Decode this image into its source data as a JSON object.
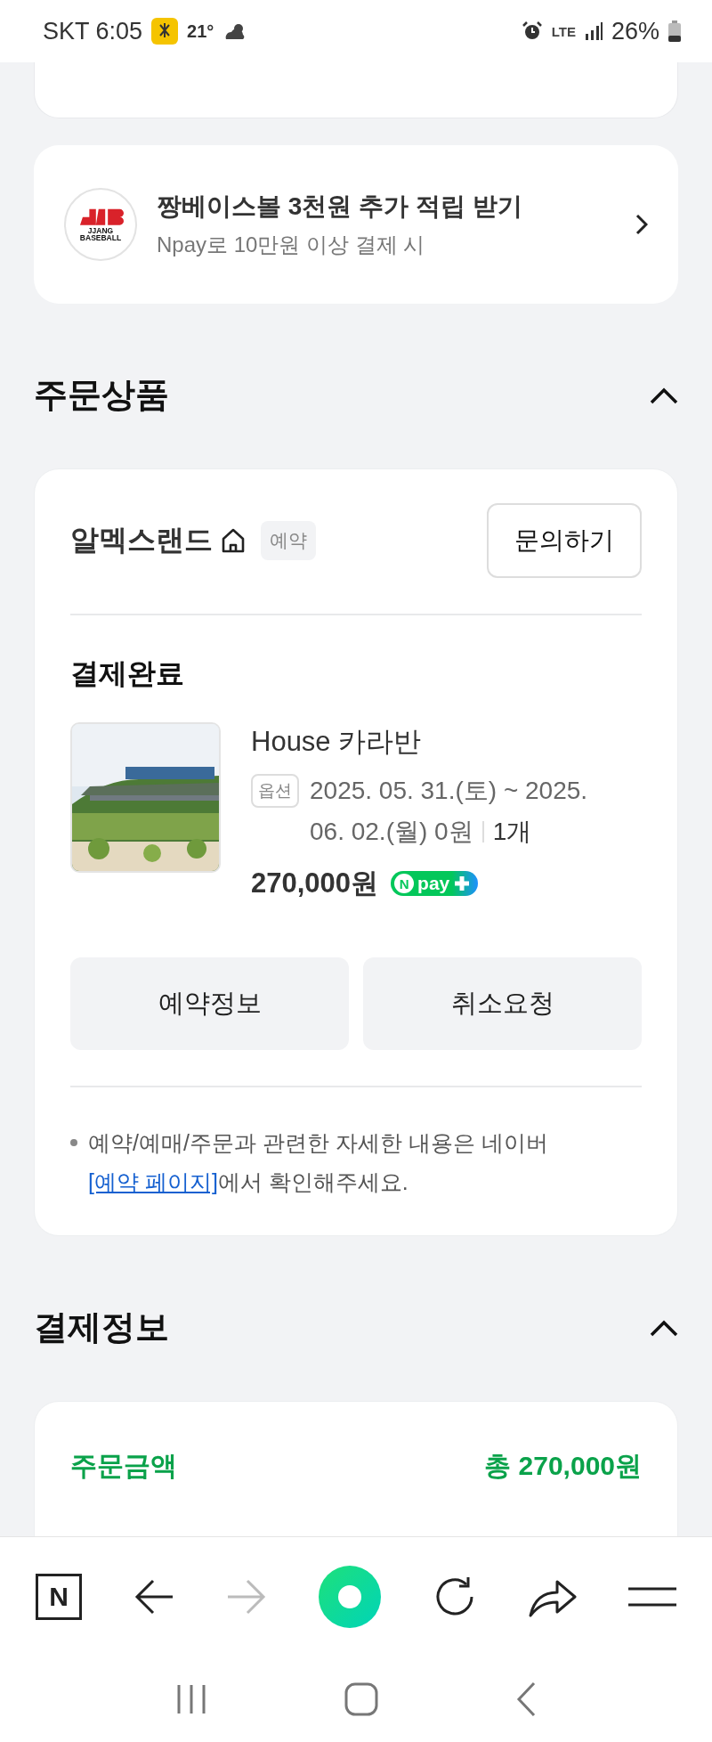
{
  "status_bar": {
    "carrier": "SKT",
    "time": "6:05",
    "temperature": "21°",
    "network": "LTE",
    "battery": "26%"
  },
  "promo": {
    "logo_caption": "JJANG BASEBALL",
    "title": "짱베이스볼 3천원 추가 적립 받기",
    "subtitle": "Npay로 10만원 이상 결제 시"
  },
  "order_section": {
    "title": "주문상품",
    "expanded": true,
    "seller": {
      "name": "알멕스랜드",
      "badge": "예약",
      "inquiry_button": "문의하기"
    },
    "status": "결제완료",
    "product": {
      "name": "House 카라반",
      "option_tag": "옵션",
      "option": "2025. 05. 31.(토) ~ 2025. 06. 02.(월) 0원",
      "quantity": "1개",
      "price": "270,000원",
      "pay_badge": {
        "mark": "N",
        "label": "pay"
      }
    },
    "buttons": [
      "예약정보",
      "취소요청"
    ],
    "notice": {
      "text": "예약/예매/주문과 관련한 자세한 내용은 네이버 ",
      "link": "[예약 페이지]",
      "after": "에서 확인해주세요."
    }
  },
  "payment_section": {
    "title": "결제정보",
    "expanded": true,
    "order_amount_label": "주문금액",
    "order_amount": "총 270,000원"
  },
  "browser_bar": {
    "logo_letter": "N"
  }
}
